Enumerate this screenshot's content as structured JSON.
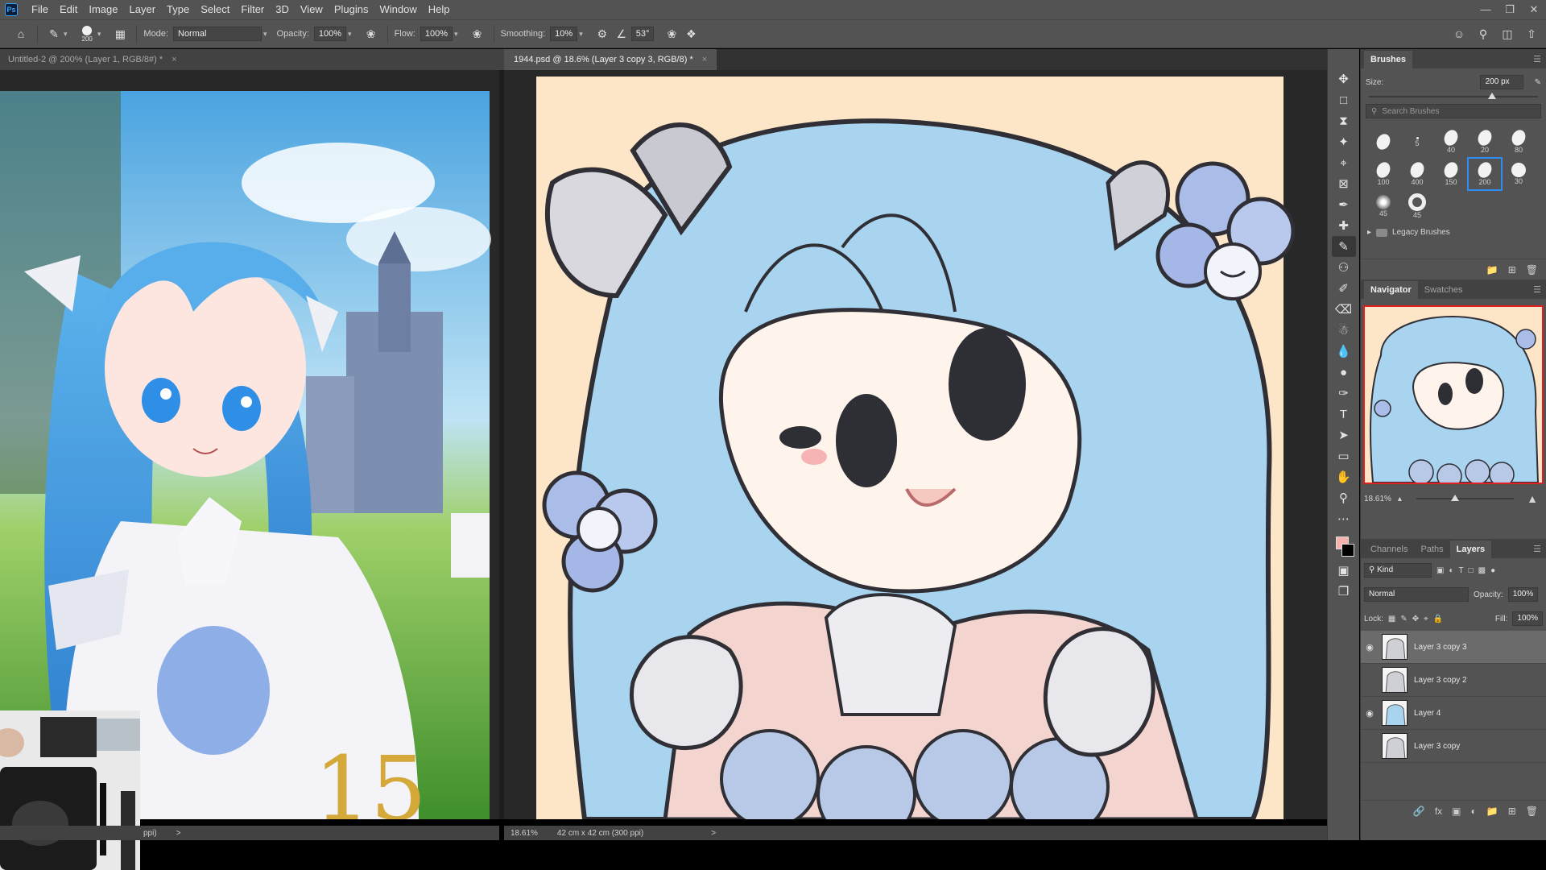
{
  "menubar": {
    "logo": "Ps",
    "items": [
      "File",
      "Edit",
      "Image",
      "Layer",
      "Type",
      "Select",
      "Filter",
      "3D",
      "View",
      "Plugins",
      "Window",
      "Help"
    ]
  },
  "options": {
    "brush_size": "200",
    "mode_label": "Mode:",
    "mode_value": "Normal",
    "opacity_label": "Opacity:",
    "opacity_value": "100%",
    "flow_label": "Flow:",
    "flow_value": "100%",
    "smoothing_label": "Smoothing:",
    "smoothing_value": "10%",
    "angle_value": "53°"
  },
  "tabs": {
    "doc1": "Untitled-2 @ 200% (Layer 1, RGB/8#) *",
    "doc2": "1944.psd @ 18.6% (Layer 3 copy 3, RGB/8) *",
    "close": "×"
  },
  "status": {
    "doc1_info": "ppi)",
    "doc2_zoom": "18.61%",
    "doc2_info": "42 cm x 42 cm (300 ppi)",
    "arrow": ">"
  },
  "brushes": {
    "title": "Brushes",
    "size_label": "Size:",
    "size_value": "200 px",
    "size_fraction": 0.73,
    "search_placeholder": "Search Brushes",
    "tips": [
      {
        "size": "",
        "kind": "oval"
      },
      {
        "size": "5",
        "kind": "dot"
      },
      {
        "size": "40",
        "kind": "oval"
      },
      {
        "size": "20",
        "kind": "oval"
      },
      {
        "size": "80",
        "kind": "oval"
      },
      {
        "size": "100",
        "kind": "oval"
      },
      {
        "size": "400",
        "kind": "oval"
      },
      {
        "size": "150",
        "kind": "oval"
      },
      {
        "size": "200",
        "kind": "oval",
        "selected": true
      },
      {
        "size": "30",
        "kind": "round"
      },
      {
        "size": "45",
        "kind": "soft"
      },
      {
        "size": "45",
        "kind": "ring"
      }
    ],
    "legacy_label": "Legacy Brushes"
  },
  "navigator": {
    "tabs": [
      "Navigator",
      "Swatches"
    ],
    "zoom_value": "18.61%",
    "zoom_fraction": 0.4
  },
  "layers": {
    "tabs": [
      "Channels",
      "Paths",
      "Layers"
    ],
    "filter_label": "Kind",
    "blend_mode": "Normal",
    "opacity_label": "Opacity:",
    "opacity_value": "100%",
    "lock_label": "Lock:",
    "fill_label": "Fill:",
    "fill_value": "100%",
    "items": [
      {
        "name": "Layer 3 copy 3",
        "visible": true,
        "active": true
      },
      {
        "name": "Layer 3 copy 2",
        "visible": false,
        "active": false
      },
      {
        "name": "Layer 4",
        "visible": true,
        "active": false
      },
      {
        "name": "Layer 3 copy",
        "visible": false,
        "active": false
      }
    ]
  },
  "colors": {
    "foreground": "#f4b3ac",
    "background": "#000000",
    "accent": "#2d8cf0",
    "navigator_frame": "#e02020"
  }
}
